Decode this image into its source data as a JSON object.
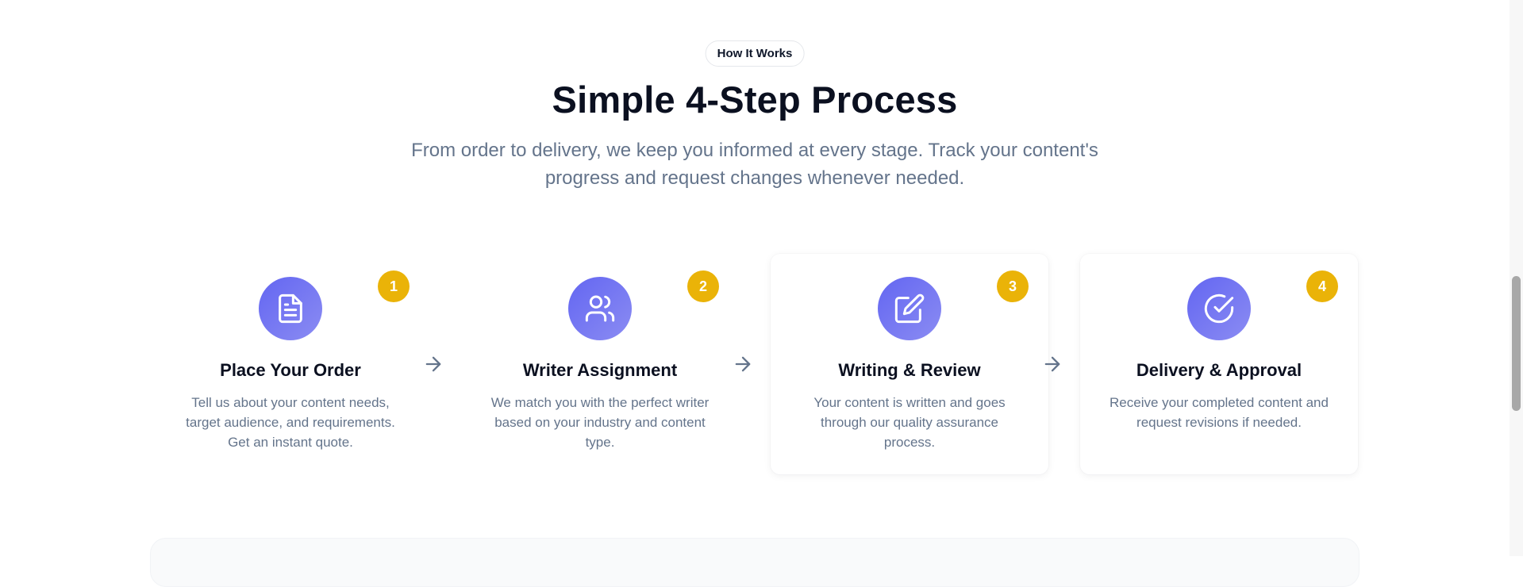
{
  "section": {
    "pill": "How It Works",
    "title": "Simple 4-Step Process",
    "subtitle": "From order to delivery, we keep you informed at every stage. Track your content's progress and request changes whenever needed."
  },
  "steps": [
    {
      "number": "1",
      "icon": "document-icon",
      "title": "Place Your Order",
      "description": "Tell us about your content needs, target audience, and requirements. Get an instant quote."
    },
    {
      "number": "2",
      "icon": "users-icon",
      "title": "Writer Assignment",
      "description": "We match you with the perfect writer based on your industry and content type."
    },
    {
      "number": "3",
      "icon": "edit-icon",
      "title": "Writing & Review",
      "description": "Your content is written and goes through our quality assurance process."
    },
    {
      "number": "4",
      "icon": "check-circle-icon",
      "title": "Delivery & Approval",
      "description": "Receive your completed content and request revisions if needed."
    }
  ],
  "colors": {
    "accent_gradient_start": "#6366f1",
    "accent_gradient_end": "#8b8cf3",
    "badge": "#eab308",
    "heading": "#0b1020",
    "muted_text": "#64748b"
  }
}
